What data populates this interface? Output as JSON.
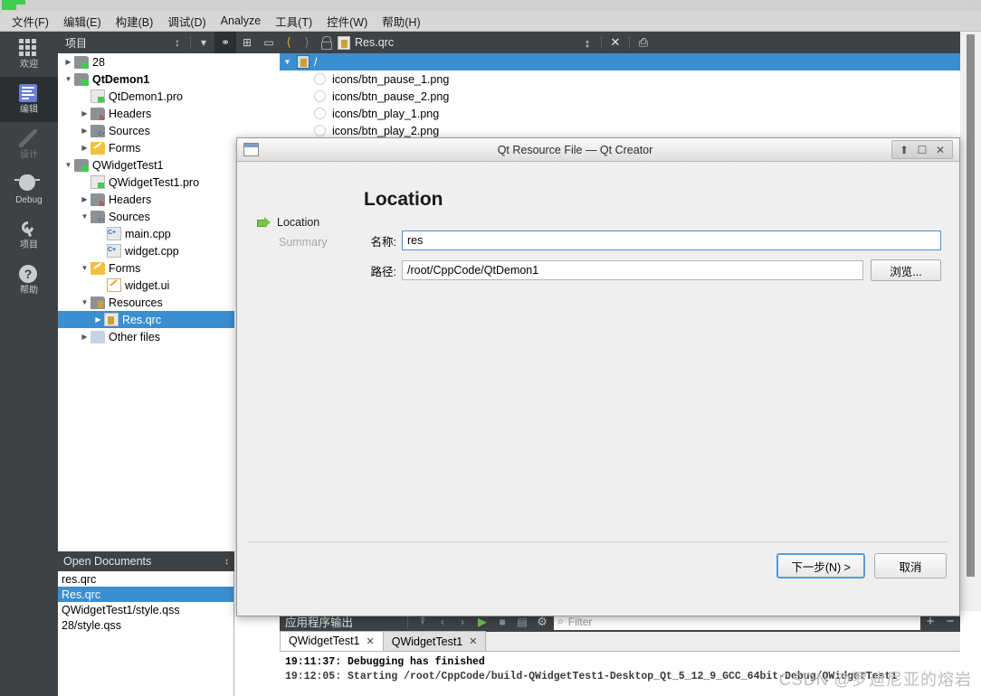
{
  "window": {
    "ghost_title": "...",
    "qt_logo": "qt-logo-icon"
  },
  "menubar": {
    "items": [
      {
        "label": "文件(F)",
        "mnemonic": "F"
      },
      {
        "label": "编辑(E)",
        "mnemonic": "E"
      },
      {
        "label": "构建(B)",
        "mnemonic": "B"
      },
      {
        "label": "调试(D)",
        "mnemonic": "D"
      },
      {
        "label": "Analyze",
        "mnemonic": "A"
      },
      {
        "label": "工具(T)",
        "mnemonic": "T"
      },
      {
        "label": "控件(W)",
        "mnemonic": "W"
      },
      {
        "label": "帮助(H)",
        "mnemonic": "H"
      }
    ]
  },
  "modebar": {
    "items": [
      {
        "label": "欢迎",
        "icon": "grid-icon",
        "active": false,
        "dim": false
      },
      {
        "label": "编辑",
        "icon": "edit-icon",
        "active": true,
        "dim": false
      },
      {
        "label": "设计",
        "icon": "pencil-icon",
        "active": false,
        "dim": true
      },
      {
        "label": "Debug",
        "icon": "bug-icon",
        "active": false,
        "dim": false
      },
      {
        "label": "项目",
        "icon": "wrench-icon",
        "active": false,
        "dim": false
      },
      {
        "label": "帮助",
        "icon": "help-icon",
        "active": false,
        "dim": false
      }
    ]
  },
  "project_panel": {
    "title": "项目",
    "toolbar": [
      {
        "name": "sort-selector-icon",
        "glyph": "↕"
      },
      {
        "name": "filter-icon",
        "glyph": "▼"
      },
      {
        "name": "link-with-editor-icon",
        "glyph": "⚭",
        "active": true
      },
      {
        "name": "split-add-icon",
        "glyph": "⊞"
      },
      {
        "name": "close-panel-icon",
        "glyph": "▭"
      }
    ],
    "tree": [
      {
        "label": "28",
        "indent": 0,
        "arrow": "collapsed",
        "icon": "folder-qt-icon",
        "bold": false,
        "selected": false
      },
      {
        "label": "QtDemon1",
        "indent": 0,
        "arrow": "expanded",
        "icon": "folder-qt-icon",
        "bold": true,
        "selected": false
      },
      {
        "label": "QtDemon1.pro",
        "indent": 1,
        "arrow": "none",
        "icon": "file-qt-icon",
        "bold": false,
        "selected": false
      },
      {
        "label": "Headers",
        "indent": 1,
        "arrow": "collapsed",
        "icon": "folder-h-icon",
        "bold": false,
        "selected": false
      },
      {
        "label": "Sources",
        "indent": 1,
        "arrow": "collapsed",
        "icon": "folder-cpp-icon",
        "bold": false,
        "selected": false
      },
      {
        "label": "Forms",
        "indent": 1,
        "arrow": "collapsed",
        "icon": "folder-ui-icon",
        "bold": false,
        "selected": false
      },
      {
        "label": "QWidgetTest1",
        "indent": 0,
        "arrow": "expanded",
        "icon": "folder-qt-icon",
        "bold": false,
        "selected": false
      },
      {
        "label": "QWidgetTest1.pro",
        "indent": 1,
        "arrow": "none",
        "icon": "file-qt-icon",
        "bold": false,
        "selected": false
      },
      {
        "label": "Headers",
        "indent": 1,
        "arrow": "collapsed",
        "icon": "folder-h-icon",
        "bold": false,
        "selected": false
      },
      {
        "label": "Sources",
        "indent": 1,
        "arrow": "expanded",
        "icon": "folder-cpp-icon",
        "bold": false,
        "selected": false
      },
      {
        "label": "main.cpp",
        "indent": 2,
        "arrow": "none",
        "icon": "file-cpp-icon",
        "bold": false,
        "selected": false
      },
      {
        "label": "widget.cpp",
        "indent": 2,
        "arrow": "none",
        "icon": "file-cpp-icon",
        "bold": false,
        "selected": false
      },
      {
        "label": "Forms",
        "indent": 1,
        "arrow": "expanded",
        "icon": "folder-ui-icon",
        "bold": false,
        "selected": false
      },
      {
        "label": "widget.ui",
        "indent": 2,
        "arrow": "none",
        "icon": "file-ui-icon",
        "bold": false,
        "selected": false
      },
      {
        "label": "Resources",
        "indent": 1,
        "arrow": "expanded",
        "icon": "folder-res-icon",
        "bold": false,
        "selected": false
      },
      {
        "label": "Res.qrc",
        "indent": 2,
        "arrow": "collapsed",
        "icon": "file-qrc-icon",
        "bold": false,
        "selected": true
      },
      {
        "label": "Other files",
        "indent": 1,
        "arrow": "collapsed",
        "icon": "folder-other-icon",
        "bold": false,
        "selected": false
      }
    ]
  },
  "open_documents": {
    "title": "Open Documents",
    "items": [
      {
        "label": "res.qrc",
        "selected": false
      },
      {
        "label": "Res.qrc",
        "selected": true
      },
      {
        "label": "QWidgetTest1/style.qss",
        "selected": false
      },
      {
        "label": "28/style.qss",
        "selected": false
      }
    ]
  },
  "editor": {
    "toolbar": {
      "back_icon": "nav-back-icon",
      "forward_icon": "nav-forward-icon",
      "lock_icon": "unlocked-icon",
      "file_icon": "qrc-file-icon",
      "filename": "Res.qrc",
      "dropdown_icon": "updown-arrow-icon",
      "close_icon": "close-document-icon",
      "split_icon": "split-editor-icon"
    },
    "resource_tree": [
      {
        "label": "/",
        "type": "prefix",
        "selected": true
      },
      {
        "label": "icons/btn_pause_1.png",
        "type": "file",
        "selected": false
      },
      {
        "label": "icons/btn_pause_2.png",
        "type": "file",
        "selected": false
      },
      {
        "label": "icons/btn_play_1.png",
        "type": "file",
        "selected": false
      },
      {
        "label": "icons/btn_play_2.png",
        "type": "file",
        "selected": false
      }
    ]
  },
  "output_pane": {
    "title": "应用程序输出",
    "buttons": [
      {
        "name": "clear-output-icon",
        "glyph": "⌗"
      },
      {
        "name": "prev-item-icon",
        "glyph": "‹"
      },
      {
        "name": "next-item-icon",
        "glyph": "›"
      },
      {
        "name": "run-icon",
        "glyph": "▶"
      },
      {
        "name": "stop-icon",
        "glyph": "■"
      },
      {
        "name": "attach-icon",
        "glyph": "▤"
      },
      {
        "name": "settings-icon",
        "glyph": "⚙"
      }
    ],
    "filter": {
      "placeholder": "Filter",
      "value": "",
      "icon": "search-icon"
    },
    "zoom_in_icon": "plus-icon",
    "zoom_out_icon": "minus-icon",
    "tabs": [
      {
        "label": "QWidgetTest1",
        "active": true,
        "close_icon": "close-tab-icon"
      },
      {
        "label": "QWidgetTest1",
        "active": false,
        "close_icon": "close-tab-icon"
      }
    ],
    "lines": [
      "19:11:37: Debugging has finished",
      "19:12:05: Starting /root/CppCode/build-QWidgetTest1-Desktop_Qt_5_12_9_GCC_64bit-Debug/QWidgetTest1"
    ]
  },
  "dialog": {
    "title": "Qt Resource File — Qt Creator",
    "icon": "window-icon",
    "titlebar_buttons": [
      {
        "name": "shade-button",
        "glyph": "⬆"
      },
      {
        "name": "maximize-button",
        "glyph": "□"
      },
      {
        "name": "close-button",
        "glyph": "✕"
      }
    ],
    "steps": [
      {
        "label": "Location",
        "state": "current"
      },
      {
        "label": "Summary",
        "state": "pending"
      }
    ],
    "heading": "Location",
    "fields": [
      {
        "label": "名称:",
        "value": "res",
        "placeholder": "",
        "focused": true,
        "name": "name-field"
      },
      {
        "label": "路径:",
        "value": "/root/CppCode/QtDemon1",
        "placeholder": "",
        "focused": false,
        "name": "path-field"
      }
    ],
    "browse_label": "浏览...",
    "actions": [
      {
        "label": "下一步(N) >",
        "default": true,
        "name": "next-button"
      },
      {
        "label": "取消",
        "default": false,
        "name": "cancel-button"
      }
    ]
  },
  "watermark": "CSDN @罗迪尼亚的熔岩",
  "colors": {
    "accent_blue": "#3b8ed0",
    "dark_chrome": "#3f4245",
    "menu_bg": "#d7d7d7",
    "dialog_bg": "#efefef",
    "focus_border": "#4a90d9",
    "qt_green": "#41cd52"
  }
}
